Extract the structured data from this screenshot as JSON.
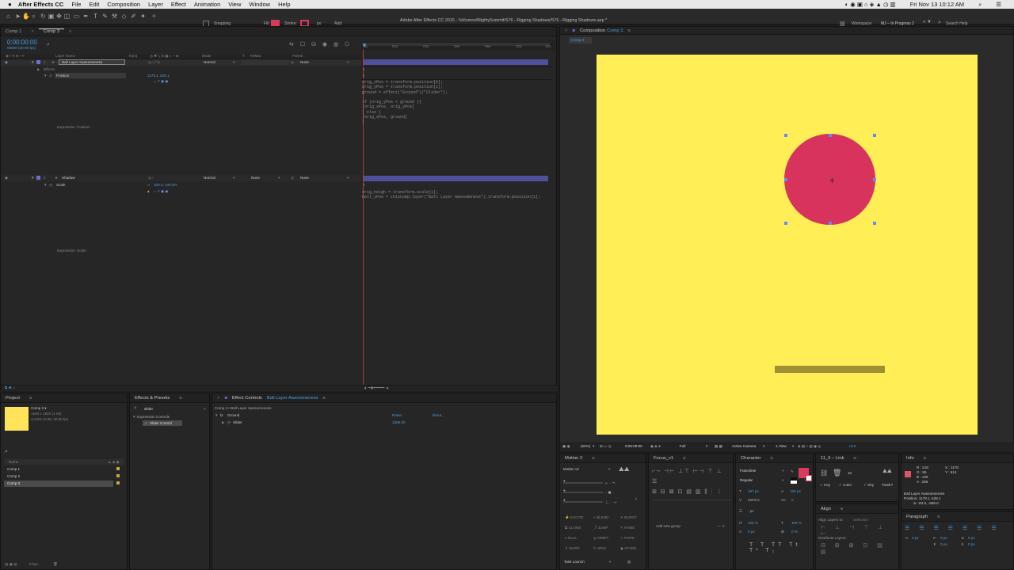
{
  "menubar": {
    "apple": "",
    "app": "After Effects CC",
    "items": [
      "File",
      "Edit",
      "Composition",
      "Layer",
      "Effect",
      "Animation",
      "View",
      "Window",
      "Help"
    ],
    "clock": "Fri Nov 13  10:12 AM"
  },
  "toolbar": {
    "snapping": "Snapping",
    "fill": "Fill:",
    "stroke": "Stroke:",
    "px": "px",
    "add": "Add:",
    "title": "Adobe After Effects CC 2015 - /Volumes/MightySummit/S76 - Rigging Shadows/S76 - Rigging Shadows.aep *",
    "workspace_label": "Workspace:",
    "workspace_value": "MJ – In Progress 2",
    "search_help": "Search Help",
    "fill_color": "#d83a5c"
  },
  "timeline": {
    "tabs": [
      "Comp 1",
      "Comp 3"
    ],
    "timecode": "0:00:00:00",
    "frames": "00000 (30.00 fps)",
    "col_headers": {
      "layer_name": "Layer Name",
      "mode": "Mode",
      "t": "T",
      "trkmat": "TrkMat",
      "parent": "Parent",
      "fx": "fx(m)"
    },
    "ruler": [
      "0s",
      "02s",
      "04s",
      "06s",
      "08s",
      "10s",
      "12s"
    ],
    "layer1": {
      "num": "1",
      "name": "Ball Layer Awesomeness",
      "mode": "Normal",
      "parent": "None"
    },
    "effects": "Effects",
    "position_label": "Position",
    "position_value": "1178.1, 628.1",
    "expr_position": "Expression: Position",
    "layer2": {
      "num": "2",
      "name": "Shadow",
      "mode": "Normal",
      "trkmat": "None",
      "parent": "None"
    },
    "scale_label": "Scale",
    "scale_value": "100.0, 100.0%",
    "expr_scale": "Expression: Scale",
    "code1": "orig_xPos = transform.position[0];\norig_yPos = transform.position[1];\nground = effect(\"Ground\")(\"Slider\");\n\nif (orig_yPos < ground ){\n[orig_xPos, orig_yPos]\n} else {\n[orig_xPos, ground]\n}",
    "code2": "orig_heigh = transform.scale[1];\nball_yPos = thisComp.layer(\"Ball Layer Awesomeness\").transform.position[1];"
  },
  "project": {
    "tab": "Project",
    "comp_name": "Comp 3 ▾",
    "comp_size": "1920 x 1920 (1.00)",
    "comp_dur": "Δ 0;00:12;00, 30.00 fps",
    "name_header": "Name",
    "items": [
      "Comp 1",
      "Comp 2",
      "Comp 3"
    ],
    "bpc": "8 bpc"
  },
  "effects_presets": {
    "tab": "Effects & Presets",
    "search": "slider",
    "category": "Expression Controls",
    "item": "Slider Control"
  },
  "effect_controls": {
    "tab": "Effect Controls",
    "tab_layer": "Ball Layer Awesomeness",
    "breadcrumb": "Comp 3 • Ball Layer Awesomeness",
    "effect": "Ground",
    "reset": "Reset",
    "about": "About...",
    "slider_label": "Slider",
    "slider_value": "1360.00"
  },
  "composition": {
    "tab_label": "Composition",
    "tab_comp": "Comp 3",
    "subtab": "Comp 3",
    "bg_color": "#ffee55",
    "ball_color": "#d8335c",
    "shadow_color": "#a09035",
    "zoom": "(50%)",
    "timecode": "0:00:00:00",
    "resolution": "Full",
    "camera": "Active Camera",
    "views": "1 View",
    "exposure": "+0.0"
  },
  "motion2": {
    "tab": "Motion 2",
    "preset": "Motion v2",
    "buttons": [
      "EXCITE",
      "BLEND",
      "BURST",
      "CLONE",
      "JUMP",
      "NAME",
      "NULL",
      "ORBIT",
      "ROPE",
      "WARP",
      "SPIN",
      "STARE"
    ],
    "task": "Task Launch"
  },
  "focus": {
    "tab": "Focus_v1",
    "add_group": "Add new group"
  },
  "character": {
    "tab": "Character",
    "font": "Franchise",
    "style": "Regular",
    "size": "187 px",
    "leading": "120 px",
    "metrics": "Metrics",
    "tracking": "0",
    "px": "- px",
    "vscale": "100 %",
    "hscale": "100 %",
    "baseline": "0 px",
    "tsume": "0 %"
  },
  "link": {
    "tab": "11_6 – Link",
    "value": "10",
    "key": "Key",
    "color": "Color",
    "shy": "Shy",
    "trash": "Trash?"
  },
  "align": {
    "tab": "Align",
    "align_to": "Align Layers to:",
    "selection": "Selection",
    "distribute": "Distribute Layers:"
  },
  "info": {
    "tab": "Info",
    "r": "R : 218",
    "g": "G : 85",
    "b": "B : 105",
    "a": "A : 255",
    "x": "X : 1178",
    "y": "Y : 614",
    "layer": "Ball Layer Awesomeness",
    "position": "Position: 1178.1, 628.1",
    "delta": "Δ: -82.0, -858.0"
  },
  "paragraph": {
    "tab": "Paragraph",
    "v1": "0 px",
    "v2": "0 px",
    "v3": "0 px",
    "v4": "0 px",
    "v5": "0 px"
  }
}
